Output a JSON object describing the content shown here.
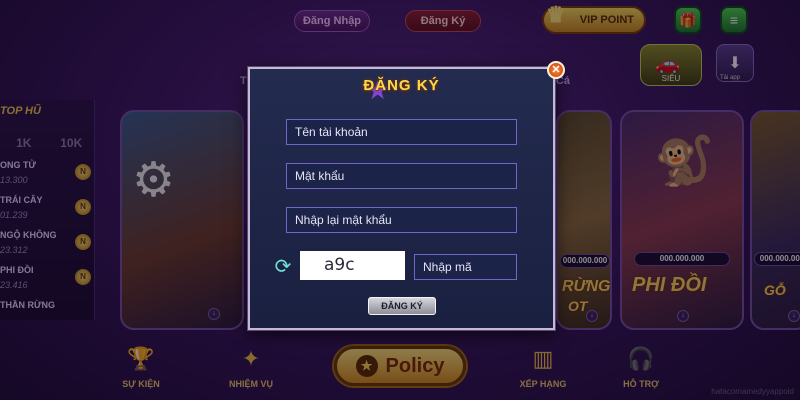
{
  "header": {
    "login_label": "Đăng Nhập",
    "register_label": "Đăng Ký",
    "vip_label": "VIP POINT",
    "car_caption": "SIÊU",
    "download_caption": "Tải app"
  },
  "top_hu": {
    "title": "TOP HŨ",
    "tabs": [
      "1K",
      "10K"
    ],
    "rows": [
      {
        "name": "ONG TỬ",
        "value": "13.300"
      },
      {
        "name": "TRÁI CÂY",
        "value": "01.239"
      },
      {
        "name": "NGỘ KHÔNG",
        "value": "23.312"
      },
      {
        "name": "PHI ĐỒI",
        "value": "23.416"
      },
      {
        "name": "THẦN RỪNG",
        "value": ""
      }
    ],
    "coin_letter": "N"
  },
  "lobby": {
    "section_left": "T",
    "section_right": "he Cá",
    "cards": [
      {
        "label": ""
      },
      {
        "label": "RỪNG"
      },
      {
        "label": "PHI ĐỒI",
        "jackpot": "000.000.000"
      },
      {
        "label": "GỖ",
        "jackpot": "000.000.000"
      }
    ],
    "card2_jackpot": "000.000.000",
    "card2_sub": "OT"
  },
  "bottom_nav": {
    "items": [
      {
        "label": "SỰ KIỆN"
      },
      {
        "label": "NHIỆM VỤ"
      },
      {
        "label": "XẾP HẠNG"
      },
      {
        "label": "HỖ TRỢ"
      }
    ],
    "policy_label": "Policy"
  },
  "modal": {
    "title": "ĐĂNG KÝ",
    "username_placeholder": "Tên tài khoản",
    "password_placeholder": "Mật khẩu",
    "repassword_placeholder": "Nhập lại mật khẩu",
    "captcha_text": "a9c",
    "captcha_placeholder": "Nhập mã",
    "submit_label": "ĐĂNG KÝ",
    "close_glyph": "✕"
  },
  "watermark": "hatacomamedyyappoid"
}
